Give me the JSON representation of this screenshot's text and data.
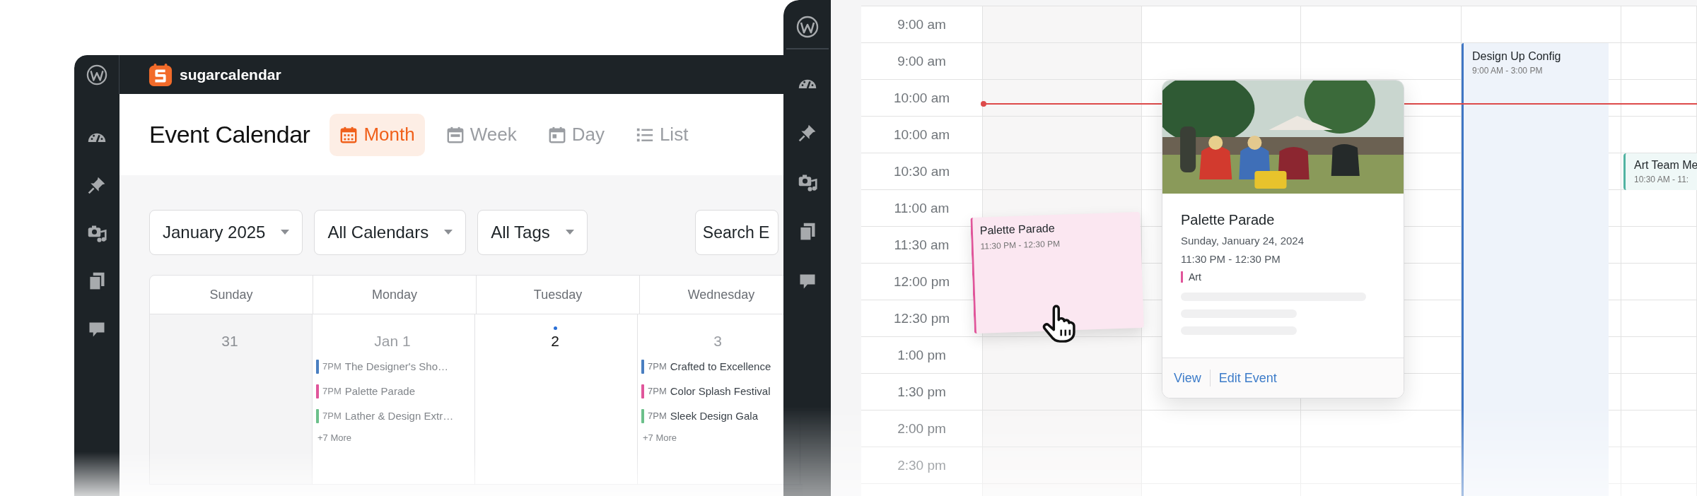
{
  "month_view": {
    "brand": "sugarcalendar",
    "title": "Event Calendar",
    "views": [
      {
        "kind": "month",
        "label": "Month",
        "selected": true
      },
      {
        "kind": "week",
        "label": "Week",
        "selected": false
      },
      {
        "kind": "day",
        "label": "Day",
        "selected": false
      },
      {
        "kind": "list",
        "label": "List",
        "selected": false
      }
    ],
    "filters": [
      {
        "value": "January 2025"
      },
      {
        "value": "All Calendars"
      },
      {
        "value": "All Tags"
      }
    ],
    "search": {
      "placeholder": "Search E"
    },
    "weekdays": [
      "Sunday",
      "Monday",
      "Tuesday",
      "Wednesday"
    ],
    "days": [
      {
        "number": "31",
        "outside_month": true,
        "today": false
      },
      {
        "number": "Jan 1",
        "outside_month": false,
        "today": false,
        "events": [
          {
            "time": "7PM",
            "title": "The Designer's Sho…",
            "color": "#4a7fc1",
            "past": true
          },
          {
            "time": "7PM",
            "title": "Palette Parade",
            "color": "#e0569b",
            "past": true
          },
          {
            "time": "7PM",
            "title": "Lather & Design Extr…",
            "color": "#6cc08b",
            "past": true
          }
        ],
        "more": "+7 More"
      },
      {
        "number": "2",
        "outside_month": false,
        "today": true
      },
      {
        "number": "3",
        "outside_month": false,
        "today": false,
        "events": [
          {
            "time": "7PM",
            "title": "Crafted to Excellence",
            "color": "#4a7fc1",
            "past": false
          },
          {
            "time": "7PM",
            "title": "Color Splash Festival",
            "color": "#e0569b",
            "past": false
          },
          {
            "time": "7PM",
            "title": "Sleek Design Gala",
            "color": "#6cc08b",
            "past": false
          }
        ],
        "more": "+7 More"
      }
    ]
  },
  "day_view": {
    "times": [
      "9:00 am",
      "9:00 am",
      "10:00 am",
      "10:00 am",
      "10:30 am",
      "11:00 am",
      "11:30 am",
      "12:00 pm",
      "12:30 pm",
      "1:00 pm",
      "1:30 pm",
      "2:00 pm",
      "2:30 pm"
    ],
    "events": [
      {
        "kind": "block",
        "title": "Design Up Config",
        "time": "9:00 AM - 3:00 PM",
        "color": "#3f76c4"
      },
      {
        "kind": "block",
        "title": "Art Team Me",
        "time": "10:30 AM - 11:",
        "color": "#52b3a2"
      },
      {
        "kind": "dragged",
        "title": "Palette Parade",
        "time": "11:30 PM - 12:30 PM",
        "color": "#e0559a"
      }
    ],
    "popup": {
      "kind": "picture",
      "title": "Palette Parade",
      "date": "Sunday, January 24, 2024",
      "time": "11:30 PM - 12:30 PM",
      "tag": {
        "label": "Art",
        "color": "#e0559a"
      },
      "actions": [
        "View",
        "Edit Event"
      ]
    }
  }
}
